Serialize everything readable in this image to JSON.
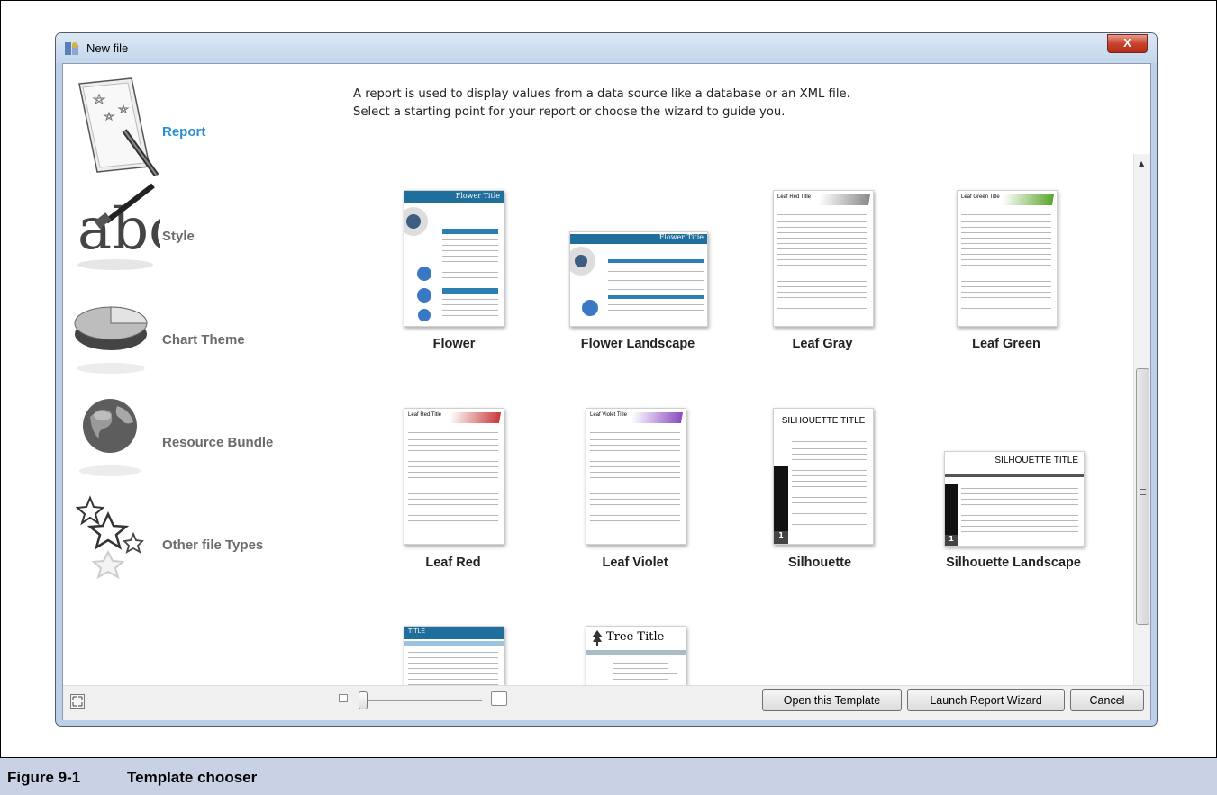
{
  "window": {
    "title": "New file",
    "close_label": "X"
  },
  "description": {
    "line1": "A report is used to display values from a data source like a database or an XML file.",
    "line2": "Select a starting point for your report or choose the wizard to guide you."
  },
  "sidebar": {
    "items": [
      {
        "label": "Report",
        "icon": "report-icon",
        "selected": true
      },
      {
        "label": "Style",
        "icon": "style-icon",
        "selected": false
      },
      {
        "label": "Chart Theme",
        "icon": "chart-theme-icon",
        "selected": false
      },
      {
        "label": "Resource Bundle",
        "icon": "globe-icon",
        "selected": false
      },
      {
        "label": "Other file Types",
        "icon": "stars-icon",
        "selected": false
      }
    ]
  },
  "templates": [
    {
      "name": "Flower",
      "header": "Flower Title"
    },
    {
      "name": "Flower Landscape",
      "header": "Flower Title"
    },
    {
      "name": "Leaf Gray",
      "header": "Leaf Red Title"
    },
    {
      "name": "Leaf Green",
      "header": "Leaf Green Title"
    },
    {
      "name": "Leaf Red",
      "header": "Leaf Red Title"
    },
    {
      "name": "Leaf Violet",
      "header": "Leaf Violet Title"
    },
    {
      "name": "Silhouette",
      "header": "SILHOUETTE TITLE"
    },
    {
      "name": "Silhouette Landscape",
      "header": "SILHOUETTE TITLE"
    },
    {
      "name": "",
      "header": "TITLE"
    },
    {
      "name": "",
      "header": "Tree Title"
    }
  ],
  "buttons": {
    "open_template": "Open this Template",
    "launch_wizard": "Launch Report Wizard",
    "cancel": "Cancel"
  },
  "caption": {
    "number": "Figure 9-1",
    "text": "Template chooser"
  },
  "colors": {
    "accent": "#2a8fd2",
    "flower_blue": "#1f6e9c",
    "leaf_gray": "#8a8a8a",
    "leaf_green": "#5aa62b",
    "leaf_red": "#c83a3a",
    "leaf_violet": "#8a4cc0"
  }
}
